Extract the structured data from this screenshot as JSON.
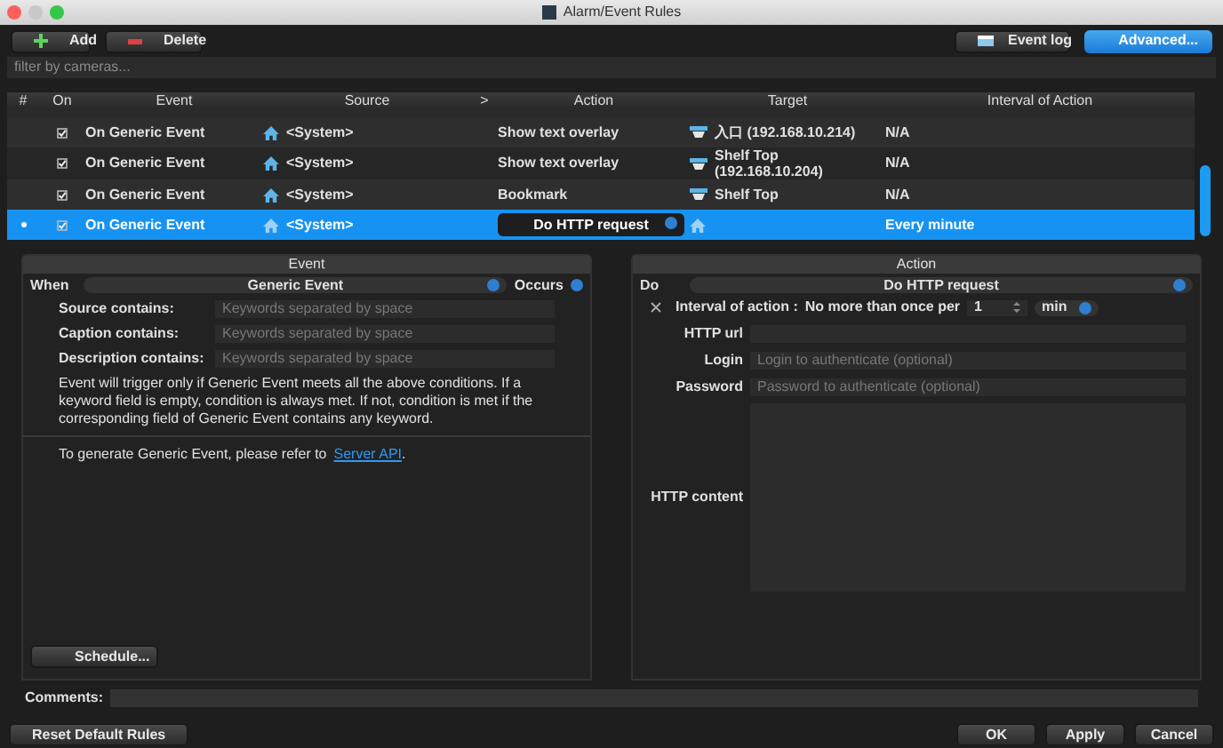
{
  "window": {
    "title": "Alarm/Event Rules"
  },
  "toolbar": {
    "add": "Add",
    "delete": "Delete",
    "event_log": "Event log",
    "advanced": "Advanced..."
  },
  "filter": {
    "placeholder": "filter by cameras..."
  },
  "table": {
    "columns": [
      "#",
      "On",
      "Event",
      "Source",
      ">",
      "Action",
      "Target",
      "Interval of Action"
    ],
    "rows": [
      {
        "checked": true,
        "event": "On Generic Event",
        "source": "<System>",
        "action": "Show text overlay",
        "target": "入口 (192.168.10.214)",
        "interval": "N/A",
        "selected": false
      },
      {
        "checked": true,
        "event": "On Generic Event",
        "source": "<System>",
        "action": "Show text overlay",
        "target": "Shelf Top (192.168.10.204)",
        "interval": "N/A",
        "selected": false
      },
      {
        "checked": true,
        "event": "On Generic Event",
        "source": "<System>",
        "action": "Bookmark",
        "target": "Shelf Top",
        "interval": "N/A",
        "selected": false
      },
      {
        "checked": true,
        "event": "On Generic Event",
        "source": "<System>",
        "action": "Do HTTP request",
        "interval": "Every minute",
        "selected": true
      }
    ]
  },
  "event_panel": {
    "title": "Event",
    "when_label": "When",
    "when_value": "Generic Event",
    "occurs": "Occurs",
    "fields": [
      {
        "label": "Source contains:",
        "placeholder": "Keywords separated by space"
      },
      {
        "label": "Caption contains:",
        "placeholder": "Keywords separated by space"
      },
      {
        "label": "Description contains:",
        "placeholder": "Keywords separated by space"
      }
    ],
    "note": "Event will trigger only if Generic Event meets all the above conditions. If a keyword field is empty, condition is always met. If not, condition is met if the corresponding field of Generic Event contains any keyword.",
    "refer_text": "To generate Generic Event, please refer to",
    "refer_link": "Server API",
    "refer_end": ".",
    "schedule": "Schedule..."
  },
  "action_panel": {
    "title": "Action",
    "do_label": "Do",
    "do_value": "Do HTTP request",
    "interval_checked": true,
    "interval_label": "Interval of action :",
    "interval_text": "No more than once per",
    "interval_value": "1",
    "interval_unit": "min",
    "fields": [
      {
        "label": "HTTP url",
        "kind": "line"
      },
      {
        "label": "Login",
        "placeholder": "Login to authenticate (optional)",
        "kind": "line"
      },
      {
        "label": "Password",
        "placeholder": "Password to authenticate (optional)",
        "kind": "line"
      },
      {
        "label": "HTTP content",
        "kind": "area"
      }
    ]
  },
  "comments": {
    "label": "Comments:"
  },
  "buttons": {
    "reset": "Reset Default Rules",
    "ok": "OK",
    "apply": "Apply",
    "cancel": "Cancel"
  }
}
